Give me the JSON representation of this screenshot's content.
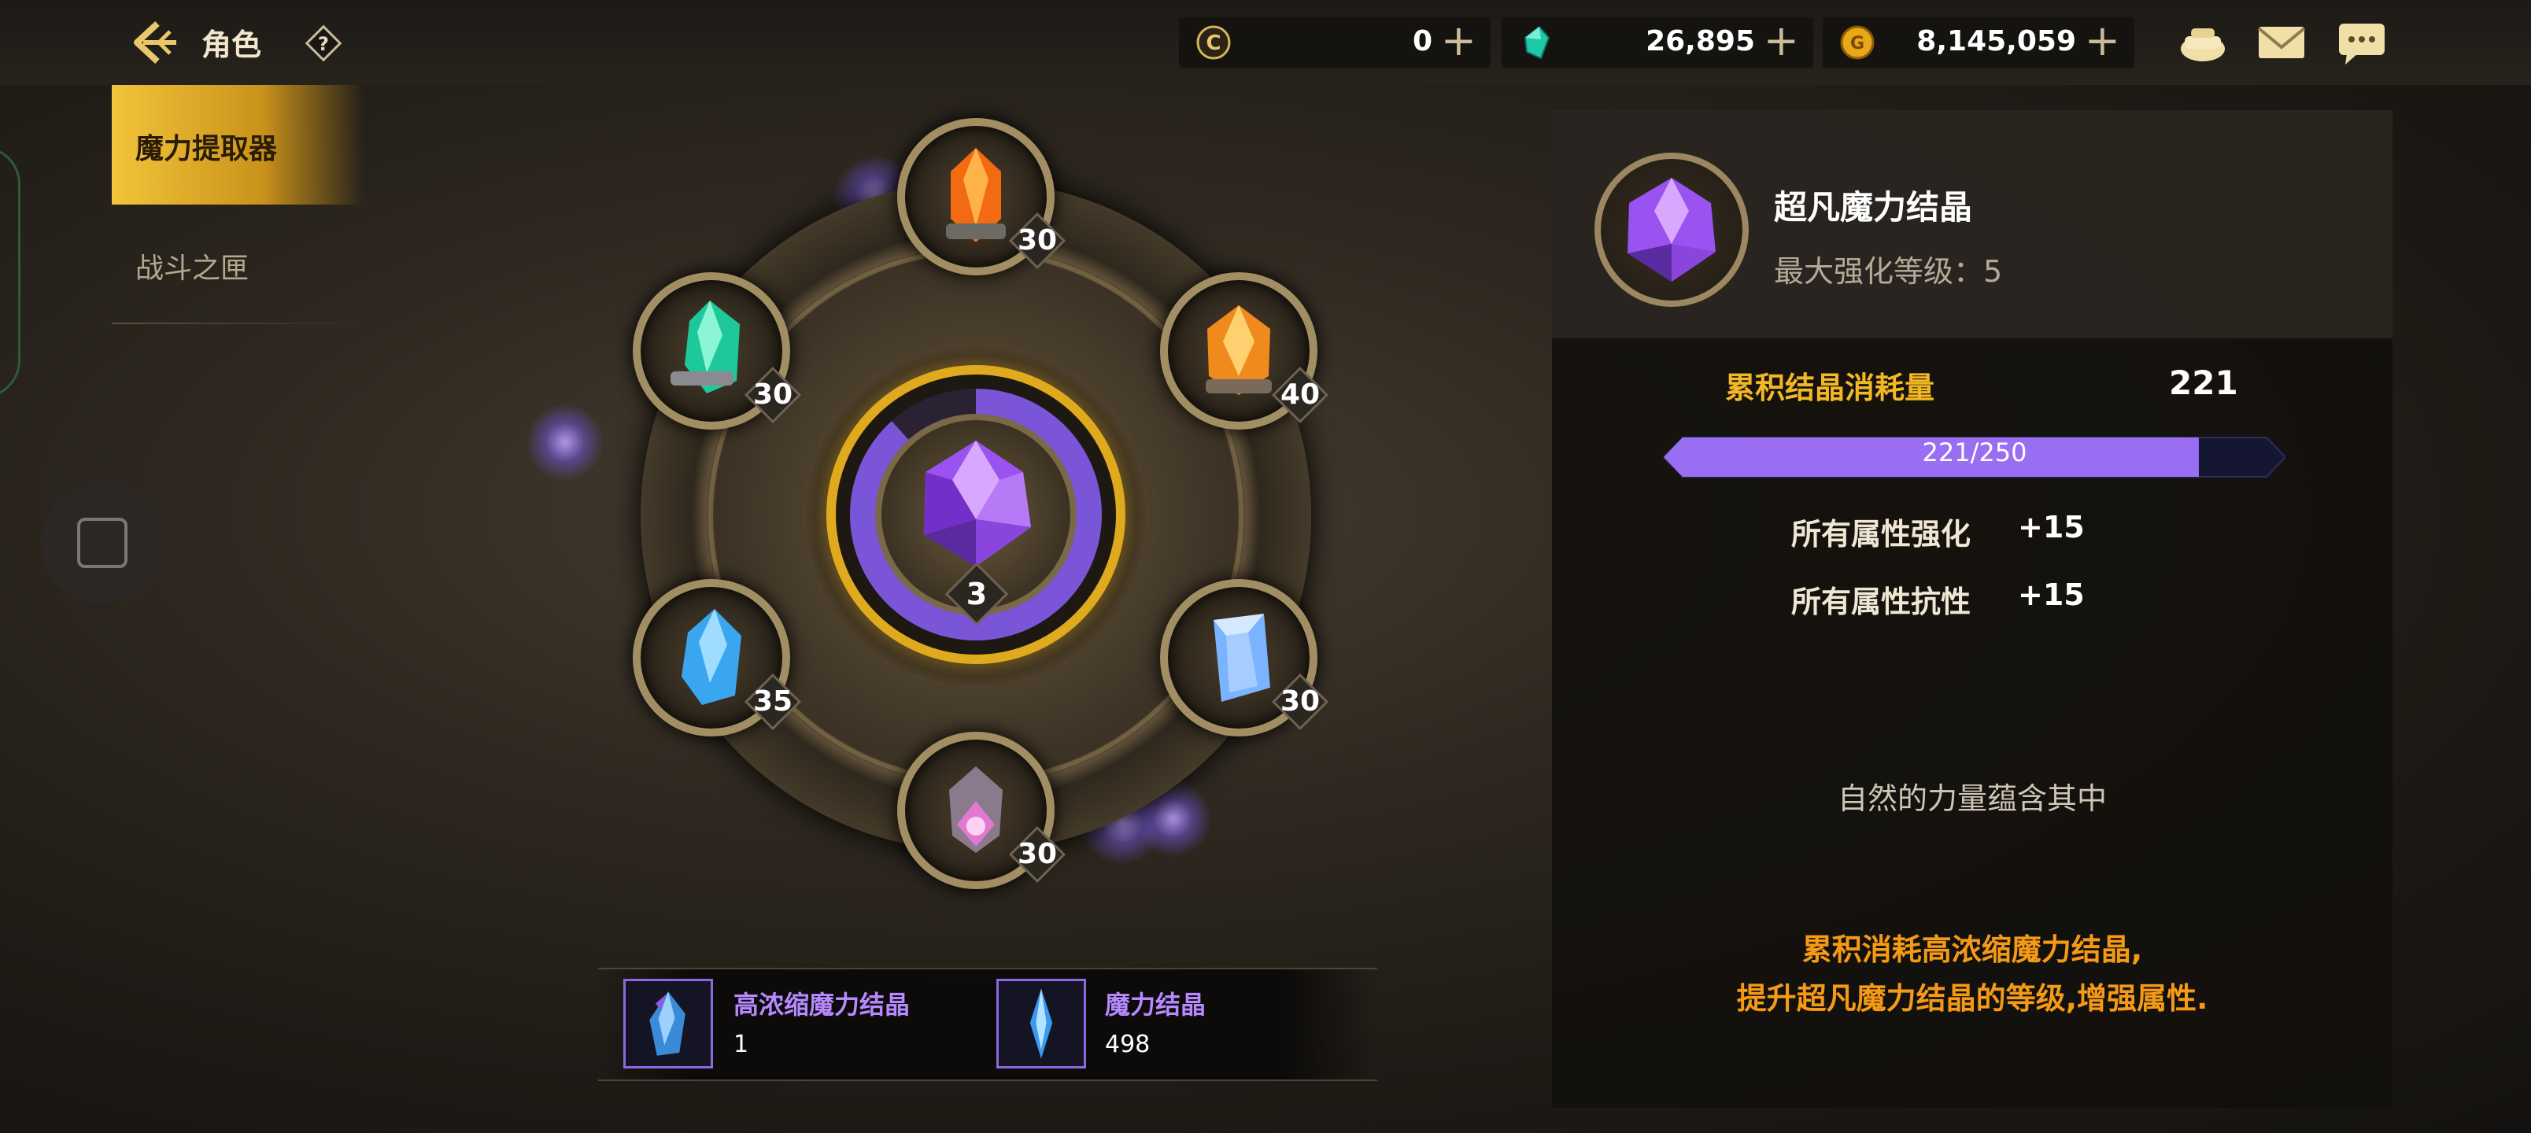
{
  "header": {
    "title": "角色",
    "back_icon": "back-arrow-icon",
    "help_icon": "help-icon"
  },
  "currencies": [
    {
      "icon": "c-coin-icon",
      "value": "0"
    },
    {
      "icon": "gem-icon",
      "value": "26,895"
    },
    {
      "icon": "gold-coin-icon",
      "value": "8,145,059"
    }
  ],
  "top_icons": [
    "bag-icon",
    "mail-icon",
    "chat-icon"
  ],
  "menu": {
    "items": [
      {
        "label": "魔力提取器",
        "active": true
      },
      {
        "label": "战斗之匣",
        "active": false
      }
    ]
  },
  "wheel": {
    "center_level": "3",
    "nodes": [
      {
        "name": "top",
        "level": "30",
        "color": "#f26a12"
      },
      {
        "name": "upper-right",
        "level": "40",
        "color": "#f08a1c"
      },
      {
        "name": "lower-right",
        "level": "30",
        "color": "#7ab4ff"
      },
      {
        "name": "bottom",
        "level": "30",
        "color": "#e07ad0"
      },
      {
        "name": "lower-left",
        "level": "35",
        "color": "#3aa6f0"
      },
      {
        "name": "upper-left",
        "level": "30",
        "color": "#1ec89a"
      }
    ]
  },
  "materials": [
    {
      "name": "高浓缩魔力结晶",
      "count": "1"
    },
    {
      "name": "魔力结晶",
      "count": "498"
    }
  ],
  "panel": {
    "item_name": "超凡魔力结晶",
    "max_level": "最大强化等级：5",
    "stat_label": "累积结晶消耗量",
    "stat_value": "221",
    "progress_text": "221/250",
    "progress_fraction": 0.884,
    "attributes": [
      {
        "name": "所有属性强化",
        "value": "+15"
      },
      {
        "name": "所有属性抗性",
        "value": "+15"
      }
    ],
    "description": "自然的力量蕴含其中",
    "hint_line1": "累积消耗高浓缩魔力结晶,",
    "hint_line2": "提升超凡魔力结晶的等级,增强属性."
  }
}
